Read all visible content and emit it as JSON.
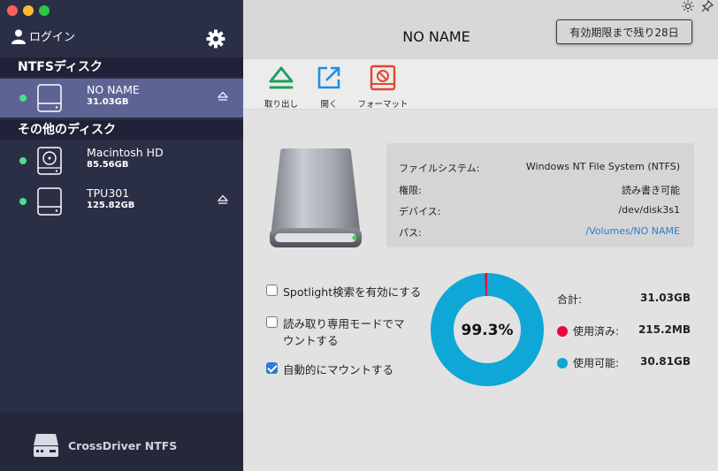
{
  "sidebar": {
    "login_label": "ログイン",
    "sections": [
      {
        "title": "NTFSディスク"
      },
      {
        "title": "その他のディスク"
      }
    ],
    "disks": [
      {
        "name": "NO NAME",
        "size": "31.03GB",
        "selected": true,
        "ejectable": true
      },
      {
        "name": "Macintosh HD",
        "size": "85.56GB",
        "selected": false,
        "ejectable": false
      },
      {
        "name": "TPU301",
        "size": "125.82GB",
        "selected": false,
        "ejectable": true
      }
    ],
    "brand": "CrossDriver NTFS"
  },
  "header": {
    "title": "NO NAME",
    "trial_badge": "有効期限まで残り28日",
    "icons": [
      "sun-icon",
      "pin-icon"
    ]
  },
  "toolbar": {
    "eject_label": "取り出し",
    "open_label": "開く",
    "format_label": "フォーマット"
  },
  "info": {
    "rows": [
      {
        "key": "ファイルシステム:",
        "value": "Windows NT File System (NTFS)"
      },
      {
        "key": "権限:",
        "value": "読み書き可能"
      },
      {
        "key": "デバイス:",
        "value": "/dev/disk3s1"
      },
      {
        "key": "パス:",
        "value": "/Volumes/NO NAME"
      }
    ]
  },
  "options": [
    {
      "label": "Spotlight検索を有効にする",
      "checked": false
    },
    {
      "label": "読み取り専用モードでマウントする",
      "checked": false
    },
    {
      "label": "自動的にマウントする",
      "checked": true
    }
  ],
  "usage": {
    "percent_label": "99.3%",
    "free_fraction": 0.993,
    "total_label": "合計:",
    "total_value": "31.03GB",
    "used_label": "使用済み:",
    "used_value": "215.2MB",
    "free_label": "使用可能:",
    "free_value": "30.81GB"
  },
  "colors": {
    "sidebar_bg": "#2b2f46",
    "selected_bg": "#5d6494",
    "online_dot": "#4be08a",
    "free": "#0ea7d6",
    "used": "#e8083e",
    "eject_green": "#1fa05a",
    "open_blue": "#1e8fe3",
    "format_red": "#e0472a"
  }
}
